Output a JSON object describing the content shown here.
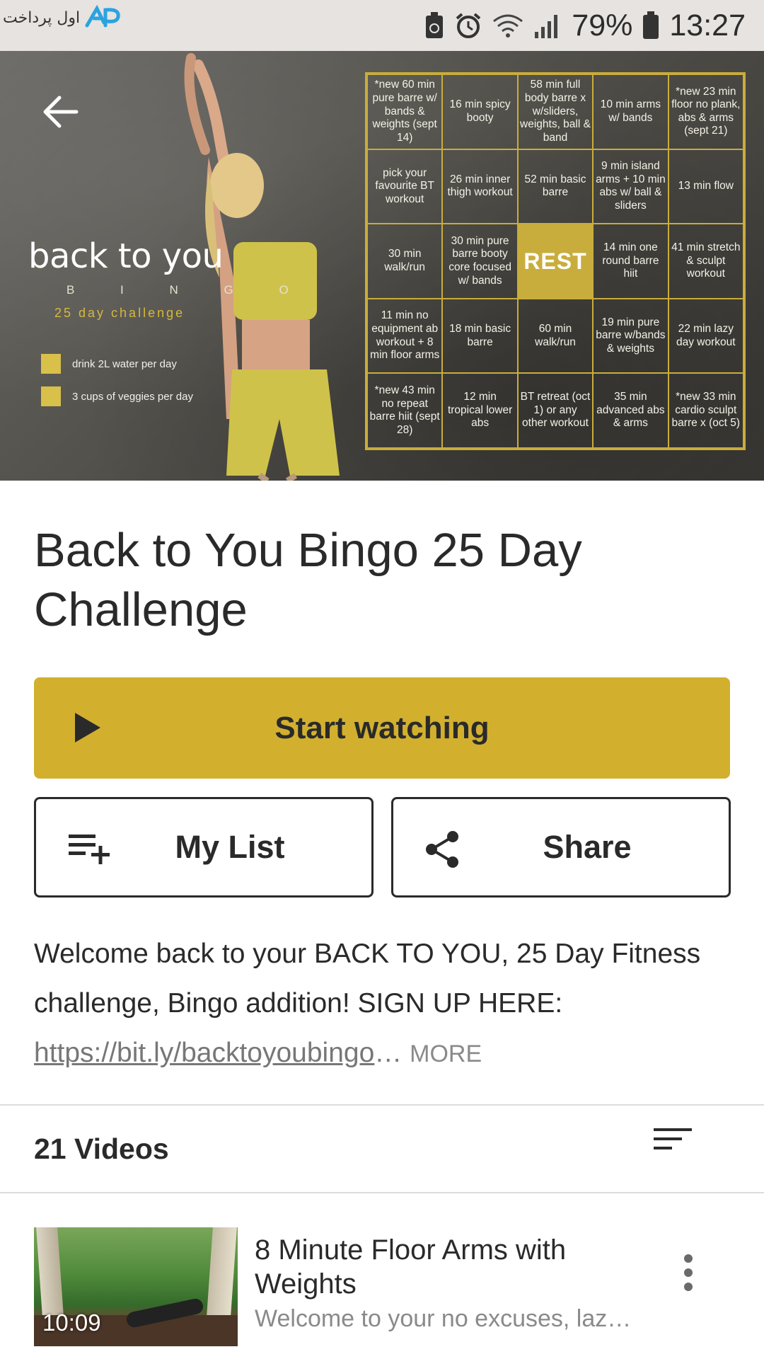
{
  "status_bar": {
    "logo_text": "اول پرداخت",
    "battery_pct": "79%",
    "time": "13:27"
  },
  "hero": {
    "title": "back to you",
    "subtitle_bingo": "B I N G O",
    "subtitle_challenge": "25 day challenge",
    "legend": [
      "drink 2L water per day",
      "3 cups of veggies per day"
    ],
    "bingo_cells": [
      "*new 60 min pure barre w/ bands & weights (sept 14)",
      "16 min spicy booty",
      "58 min full body barre x w/sliders, weights, ball & band",
      "10 min arms w/ bands",
      "*new 23 min floor no plank, abs & arms (sept 21)",
      "pick your favourite BT workout",
      "26 min inner thigh workout",
      "52 min basic barre",
      "9 min island arms + 10 min abs w/ ball & sliders",
      "13 min flow",
      "30 min walk/run",
      "30 min pure barre booty core focused w/ bands",
      "REST",
      "14 min one round barre hiit",
      "41 min stretch & sculpt workout",
      "11 min no equipment ab workout + 8 min floor arms",
      "18 min basic barre",
      "60 min walk/run",
      "19 min pure barre w/bands & weights",
      "22 min lazy day workout",
      "*new 43 min no repeat barre hiit (sept 28)",
      "12 min tropical lower abs",
      "BT retreat (oct 1) or any other workout",
      "35 min advanced abs & arms",
      "*new 33 min cardio sculpt barre x (oct 5)"
    ],
    "accent_color": "#c9ad3c"
  },
  "page": {
    "title": "Back to You Bingo 25 Day Challenge",
    "start_label": "Start watching",
    "mylist_label": "My List",
    "share_label": "Share",
    "description_text": "Welcome back to your BACK TO YOU, 25 Day Fitness challenge, Bingo addition! SIGN UP HERE: ",
    "description_link": "https://bit.ly/backtoyoubingo",
    "description_ellipsis": "…",
    "description_more": "MORE",
    "videos_count": "21 Videos",
    "accent_color": "#d2b02e"
  },
  "videos": [
    {
      "title": "8 Minute Floor Arms with Weights",
      "description": "Welcome to your no excuses, laz…",
      "duration": "10:09"
    }
  ]
}
